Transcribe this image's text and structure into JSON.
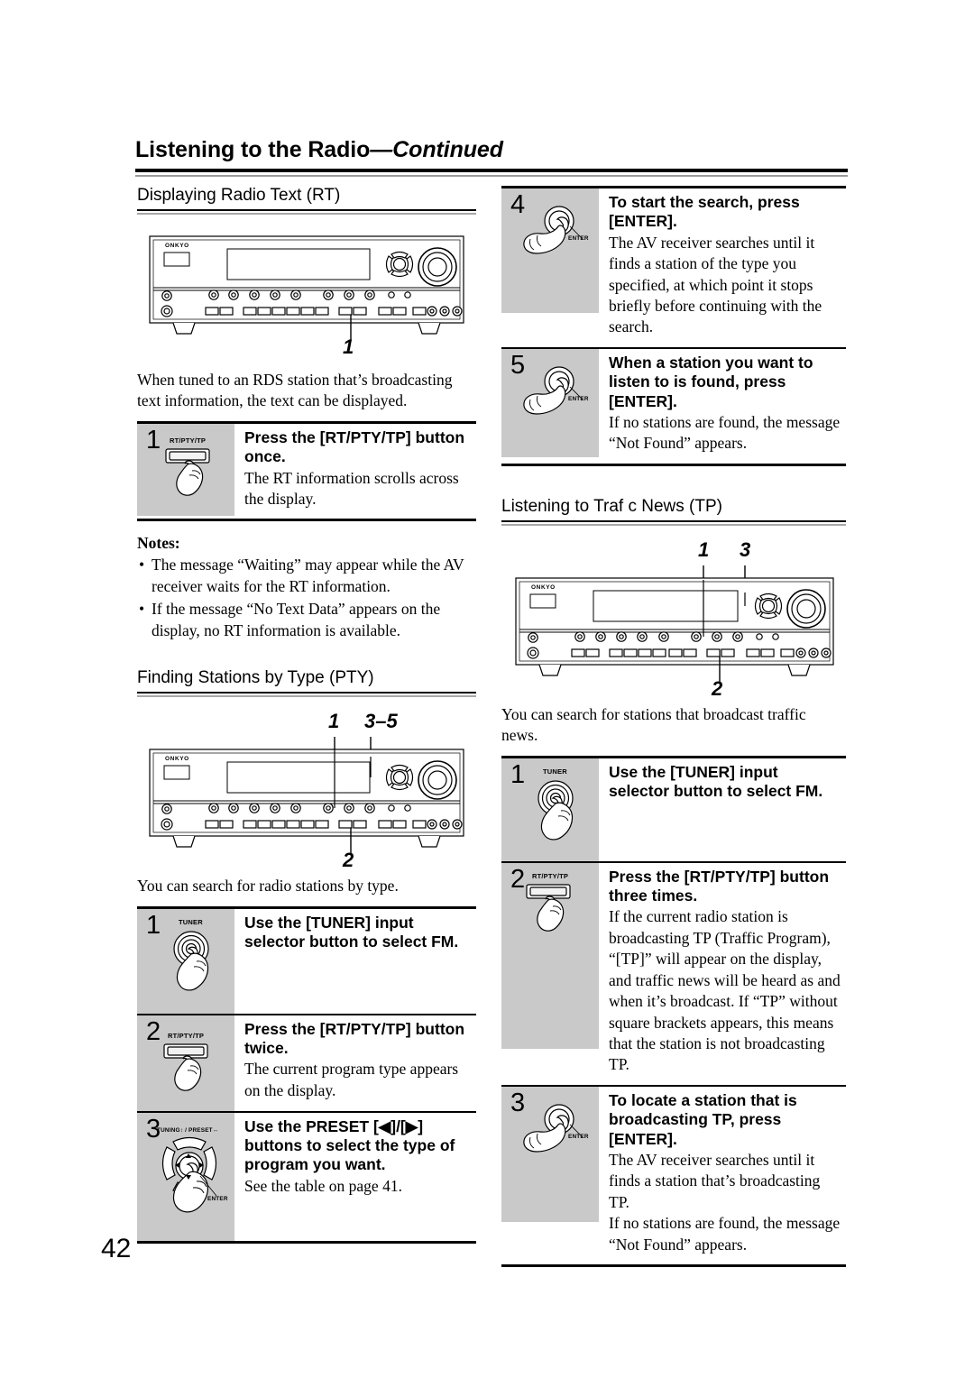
{
  "header": {
    "title_main": "Listening to the Radio",
    "title_cont": "—Continued"
  },
  "page_number": "42",
  "left_column": {
    "section_rt": {
      "heading": "Displaying Radio Text (RT)",
      "diagram_callouts": [
        "1"
      ],
      "intro": "When tuned to an RDS station that’s broadcasting text information, the text can be displayed.",
      "steps": [
        {
          "num": "1",
          "icon_label": "RT/PTY/TP",
          "icon": "rect-button-with-hand",
          "head": "Press the [RT/PTY/TP] button once.",
          "text": [
            "The RT information scrolls across the display."
          ]
        }
      ],
      "notes_title": "Notes:",
      "notes": [
        "The message “Waiting” may appear while the AV receiver waits for the RT information.",
        "If the message “No Text Data” appears on the display, no RT information is available."
      ]
    },
    "section_pty": {
      "heading": "Finding Stations by Type (PTY)",
      "diagram_callouts_top": [
        "1",
        "3–5"
      ],
      "diagram_callouts_bottom": [
        "2"
      ],
      "intro": "You can search for radio stations by type.",
      "steps": [
        {
          "num": "1",
          "icon_label": "TUNER",
          "icon": "round-knob-with-hand",
          "head": "Use the [TUNER] input selector button to select FM.",
          "text": []
        },
        {
          "num": "2",
          "icon_label": "RT/PTY/TP",
          "icon": "rect-button-with-hand",
          "head": "Press the [RT/PTY/TP] button twice.",
          "text": [
            "The current program type appears on the display."
          ]
        },
        {
          "num": "3",
          "icon_label": "TUNING↕ / PRESET↔",
          "icon_label2": "ENTER",
          "icon": "nav-pad-with-hand",
          "head": "Use the PRESET [◀]/[▶] buttons to select the type of program you want.",
          "text": [
            "See the table on page 41."
          ]
        }
      ]
    }
  },
  "right_column": {
    "section_pty_cont": {
      "steps": [
        {
          "num": "4",
          "icon_label": "ENTER",
          "icon": "enter-button-with-hand",
          "head": "To start the search, press [ENTER].",
          "text": [
            "The AV receiver searches until it finds a station of the type you specified, at which point it stops briefly before continuing with the search."
          ]
        },
        {
          "num": "5",
          "icon_label": "ENTER",
          "icon": "enter-button-with-hand",
          "head": "When a station you want to listen to is found, press [ENTER].",
          "text": [
            "If no stations are found, the message “Not Found” appears."
          ]
        }
      ]
    },
    "section_tp": {
      "heading": "Listening to Traf c News (TP)",
      "diagram_callouts_top": [
        "1",
        "3"
      ],
      "diagram_callouts_bottom": [
        "2"
      ],
      "intro": "You can search for stations that broadcast traffic news.",
      "steps": [
        {
          "num": "1",
          "icon_label": "TUNER",
          "icon": "round-knob-with-hand",
          "head": "Use the [TUNER] input selector button to select FM.",
          "text": []
        },
        {
          "num": "2",
          "icon_label": "RT/PTY/TP",
          "icon": "rect-button-with-hand",
          "head": "Press the [RT/PTY/TP] button three times.",
          "text": [
            "If the current radio station is broadcasting TP (Traffic Program), “[TP]” will appear on the display, and traffic news will be heard as and when it’s broadcast. If “TP” without square brackets appears, this means that the station is not broadcasting TP."
          ]
        },
        {
          "num": "3",
          "icon_label": "ENTER",
          "icon": "enter-button-with-hand",
          "head": "To locate a station that is broadcasting TP, press [ENTER].",
          "text": [
            "The AV receiver searches until it finds a station that’s broadcasting TP.",
            "If no stations are found, the message “Not Found” appears."
          ]
        }
      ]
    }
  },
  "receiver_diagram": {
    "brand": "ONKYO",
    "alt": "Onkyo AV receiver front panel line drawing"
  }
}
